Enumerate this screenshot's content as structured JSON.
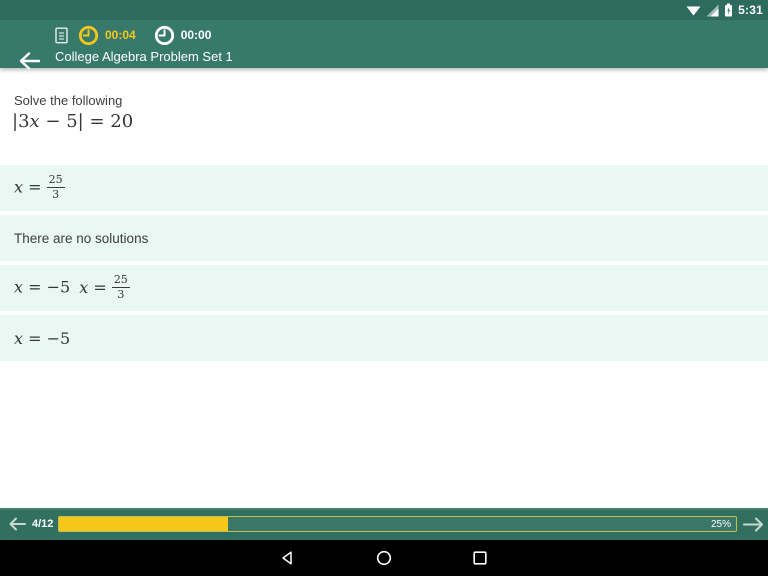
{
  "status_bar": {
    "time": "5:31"
  },
  "app_bar": {
    "title": "College Algebra Problem Set 1",
    "elapsed_timer": "00:04",
    "total_timer": "00:00"
  },
  "question": {
    "prompt": "Solve the following",
    "equation": {
      "pre": "|3",
      "variable": "x",
      "post": " − 5| = 20"
    }
  },
  "answers": [
    {
      "type": "math-fraction",
      "variable": "x",
      "relation": " = ",
      "numerator": "25",
      "denominator": "3"
    },
    {
      "type": "text",
      "text": "There are no solutions"
    },
    {
      "type": "math-double",
      "part1_variable": "x",
      "part1_rest": " = −5",
      "part2_variable": "x",
      "part2_relation": " = ",
      "numerator": "25",
      "denominator": "3"
    },
    {
      "type": "math-simple",
      "variable": "x",
      "rest": " = −5"
    }
  ],
  "bottom_bar": {
    "counter": "4/12",
    "progress_percent": 25,
    "percent_label": "25%"
  },
  "colors": {
    "status_bar": "#2d6b5e",
    "app_bar": "#37796b",
    "bottom_bar": "#31705f",
    "accent_yellow": "#F5C71B",
    "answer_row_bg": "#e9f8f2"
  }
}
